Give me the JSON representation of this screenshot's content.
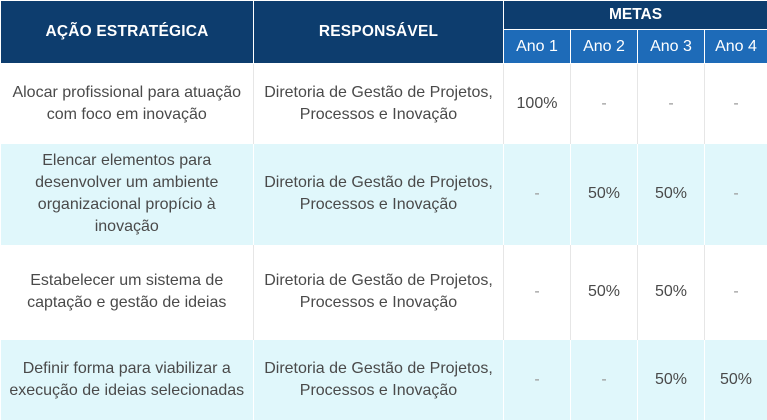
{
  "header": {
    "col_action": "AÇÃO ESTRATÉGICA",
    "col_responsible": "RESPONSÁVEL",
    "col_goals": "METAS",
    "years": [
      "Ano 1",
      "Ano 2",
      "Ano 3",
      "Ano 4"
    ]
  },
  "rows": [
    {
      "action": "Alocar profissional para atuação com foco em inovação",
      "responsible": "Diretoria de Gestão de Projetos, Processos e Inovação",
      "goals": [
        "100%",
        "-",
        "-",
        "-"
      ]
    },
    {
      "action": "Elencar elementos para desenvolver um ambiente organizacional propício à inovação",
      "responsible": "Diretoria de Gestão de Projetos, Processos e Inovação",
      "goals": [
        "-",
        "50%",
        "50%",
        "-"
      ]
    },
    {
      "action": "Estabelecer um sistema de captação e gestão de ideias",
      "responsible": "Diretoria de Gestão de Projetos, Processos e Inovação",
      "goals": [
        "-",
        "50%",
        "50%",
        "-"
      ]
    },
    {
      "action": "Definir forma para viabilizar a execução de ideias selecionadas",
      "responsible": "Diretoria de Gestão de Projetos, Processos e Inovação",
      "goals": [
        "-",
        "-",
        "50%",
        "50%"
      ]
    }
  ],
  "colors": {
    "header_dark": "#0d3d6e",
    "header_year": "#1e6bb8",
    "row_alt": "#e0f7fb",
    "text": "#4a4a4a"
  }
}
